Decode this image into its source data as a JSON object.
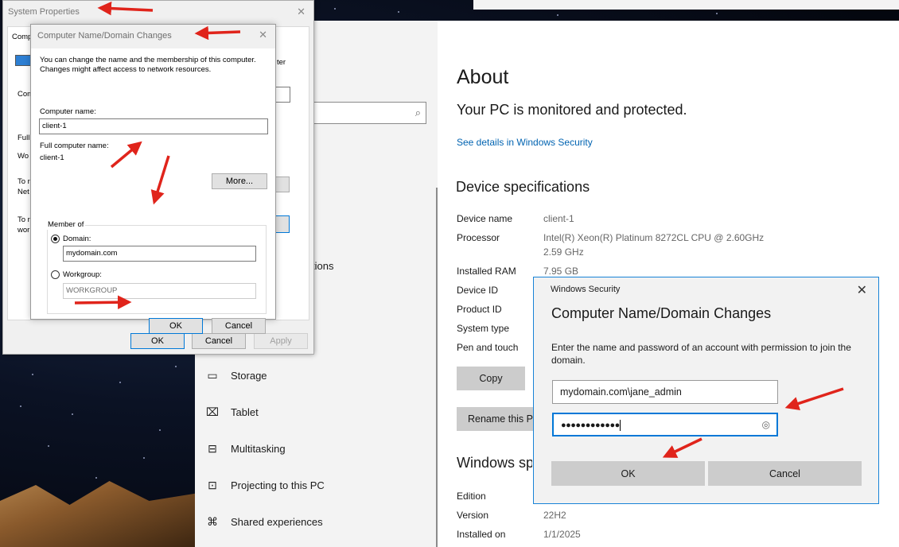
{
  "settings": {
    "nav_partial": "tions",
    "nav_items": [
      {
        "label": "Storage",
        "icon": "storage-icon"
      },
      {
        "label": "Tablet",
        "icon": "tablet-icon"
      },
      {
        "label": "Multitasking",
        "icon": "multitasking-icon"
      },
      {
        "label": "Projecting to this PC",
        "icon": "projecting-icon"
      },
      {
        "label": "Shared experiences",
        "icon": "shared-experiences-icon"
      }
    ],
    "about_title": "About",
    "protected_text": "Your PC is monitored and protected.",
    "security_link": "See details in Windows Security",
    "device_specs_title": "Device specifications",
    "specs": [
      {
        "label": "Device name",
        "value": "client-1"
      },
      {
        "label": "Processor",
        "value": "Intel(R) Xeon(R) Platinum 8272CL CPU @ 2.60GHz",
        "value2": "2.59 GHz"
      },
      {
        "label": "Installed RAM",
        "value": "7.95 GB"
      },
      {
        "label": "Device ID",
        "value": ""
      },
      {
        "label": "Product ID",
        "value": ""
      },
      {
        "label": "System type",
        "value": ""
      },
      {
        "label": "Pen and touch",
        "value": ""
      }
    ],
    "copy_label": "Copy",
    "rename_label": "Rename this P",
    "windows_specs_title": "Windows specifications",
    "win_specs": [
      {
        "label": "Edition",
        "value": ""
      },
      {
        "label": "Version",
        "value": "22H2"
      },
      {
        "label": "Installed on",
        "value": "1/1/2025"
      }
    ]
  },
  "system_properties": {
    "title": "System Properties",
    "frags": [
      "Comp",
      "Com",
      "Full",
      "Wo",
      "To r",
      "Net",
      "To r",
      "wor",
      "ter"
    ],
    "ok": "OK",
    "cancel": "Cancel",
    "apply": "Apply"
  },
  "cn_dialog": {
    "title": "Computer Name/Domain Changes",
    "intro": "You can change the name and the membership of this computer. Changes might affect access to network resources.",
    "computer_name_label": "Computer name:",
    "computer_name_value": "client-1",
    "full_name_label": "Full computer name:",
    "full_name_value": "client-1",
    "more_label": "More...",
    "member_of_label": "Member of",
    "domain_label": "Domain:",
    "domain_value": "mydomain.com",
    "domain_selected": true,
    "workgroup_label": "Workgroup:",
    "workgroup_value": "WORKGROUP",
    "ok": "OK",
    "cancel": "Cancel"
  },
  "windows_security": {
    "app_name": "Windows Security",
    "heading": "Computer Name/Domain Changes",
    "message": "Enter the name and password of an account with permission to join the domain.",
    "username_value": "mydomain.com\\jane_admin",
    "password_mask": "●●●●●●●●●●●●",
    "ok": "OK",
    "cancel": "Cancel"
  },
  "colors": {
    "link": "#0063b1",
    "accent": "#0078d7",
    "annotation_arrow": "#e0241b"
  }
}
